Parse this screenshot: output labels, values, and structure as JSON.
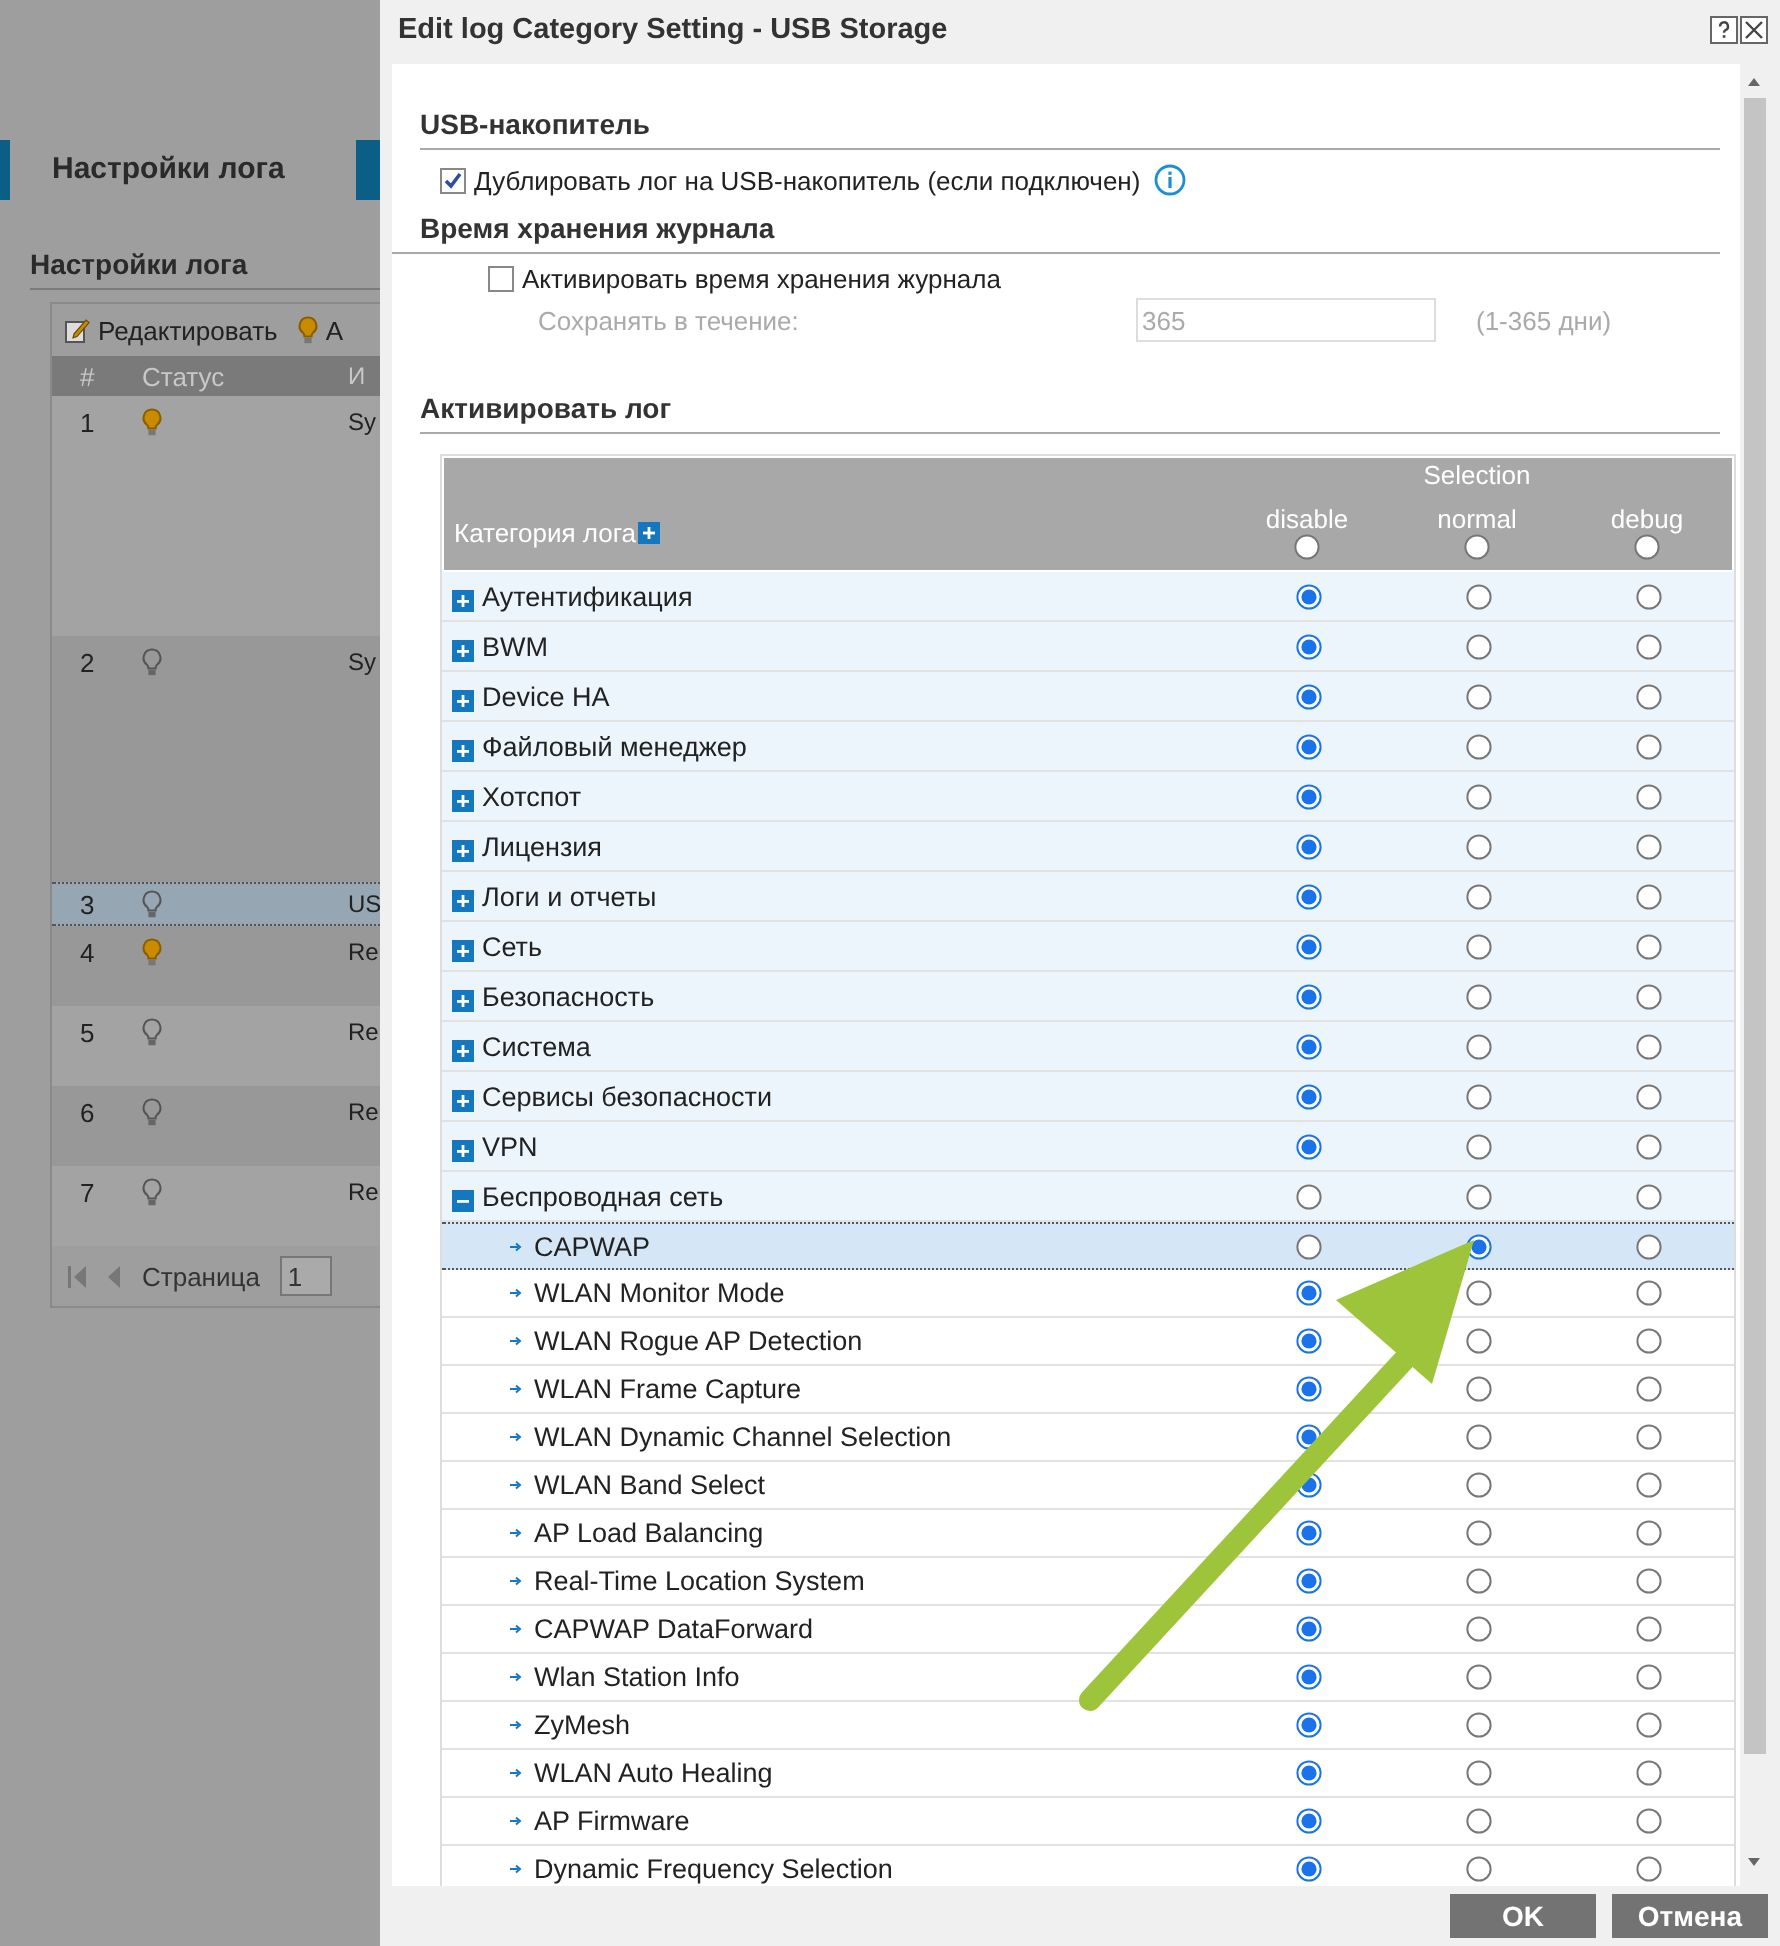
{
  "background_page": {
    "tab": {
      "label": "Настройки лога",
      "selected": true
    },
    "section_title": "Настройки лога",
    "toolbar": [
      {
        "label": "Редактировать",
        "kind": "edit"
      },
      {
        "label": "А",
        "kind": "activate"
      }
    ],
    "columns": [
      "#",
      "Статус",
      "И"
    ],
    "rows": [
      {
        "number": "1",
        "active": true,
        "name": "Sy",
        "selected": false
      },
      {
        "number": "2",
        "active": false,
        "name": "Sy",
        "selected": false
      },
      {
        "number": "3",
        "active": false,
        "name": "US",
        "selected": true
      },
      {
        "number": "4",
        "active": true,
        "name": "Re",
        "selected": false
      },
      {
        "number": "5",
        "active": false,
        "name": "Re",
        "selected": false
      },
      {
        "number": "6",
        "active": false,
        "name": "Re",
        "selected": false
      },
      {
        "number": "7",
        "active": false,
        "name": "Re",
        "selected": false
      }
    ],
    "pager": {
      "label": "Страница",
      "page": "1"
    }
  },
  "dialog": {
    "title": "Edit log Category Setting - USB Storage",
    "usb_section": {
      "title": "USB-накопитель",
      "duplicate": {
        "label": "Дублировать лог на USB-накопитель (если подключен)",
        "checked": true
      }
    },
    "retention_section": {
      "title": "Время хранения журнала",
      "enable": {
        "label": "Активировать время хранения журнала",
        "checked": false
      },
      "keep_label": "Сохранять в течение:",
      "keep_value": "365",
      "range_hint": "(1-365 дни)"
    },
    "log_section": {
      "title": "Активировать лог",
      "table": {
        "category_header": "Категория лога",
        "group_header": "Selection",
        "options": [
          "disable",
          "normal",
          "debug"
        ],
        "header_choices": [
          {
            "selected": false
          },
          {
            "selected": false
          },
          {
            "selected": false
          }
        ],
        "rows": [
          {
            "name": "Аутентификация",
            "expanded": false,
            "selected": false,
            "choices": [
              {
                "selected": true
              },
              {
                "selected": false
              },
              {
                "selected": false
              }
            ]
          },
          {
            "name": "BWM",
            "expanded": false,
            "selected": false,
            "choices": [
              {
                "selected": true
              },
              {
                "selected": false
              },
              {
                "selected": false
              }
            ]
          },
          {
            "name": "Device HA",
            "expanded": false,
            "selected": false,
            "choices": [
              {
                "selected": true
              },
              {
                "selected": false
              },
              {
                "selected": false
              }
            ]
          },
          {
            "name": "Файловый менеджер",
            "expanded": false,
            "selected": false,
            "choices": [
              {
                "selected": true
              },
              {
                "selected": false
              },
              {
                "selected": false
              }
            ]
          },
          {
            "name": "Хотспот",
            "expanded": false,
            "selected": false,
            "choices": [
              {
                "selected": true
              },
              {
                "selected": false
              },
              {
                "selected": false
              }
            ]
          },
          {
            "name": "Лицензия",
            "expanded": false,
            "selected": false,
            "choices": [
              {
                "selected": true
              },
              {
                "selected": false
              },
              {
                "selected": false
              }
            ]
          },
          {
            "name": "Логи и отчеты",
            "expanded": false,
            "selected": false,
            "choices": [
              {
                "selected": true
              },
              {
                "selected": false
              },
              {
                "selected": false
              }
            ]
          },
          {
            "name": "Сеть",
            "expanded": false,
            "selected": false,
            "choices": [
              {
                "selected": true
              },
              {
                "selected": false
              },
              {
                "selected": false
              }
            ]
          },
          {
            "name": "Безопасность",
            "expanded": false,
            "selected": false,
            "choices": [
              {
                "selected": true
              },
              {
                "selected": false
              },
              {
                "selected": false
              }
            ]
          },
          {
            "name": "Система",
            "expanded": false,
            "selected": false,
            "choices": [
              {
                "selected": true
              },
              {
                "selected": false
              },
              {
                "selected": false
              }
            ]
          },
          {
            "name": "Сервисы безопасности",
            "expanded": false,
            "selected": false,
            "choices": [
              {
                "selected": true
              },
              {
                "selected": false
              },
              {
                "selected": false
              }
            ]
          },
          {
            "name": "VPN",
            "expanded": false,
            "selected": false,
            "choices": [
              {
                "selected": true
              },
              {
                "selected": false
              },
              {
                "selected": false
              }
            ]
          },
          {
            "name": "Беспроводная сеть",
            "expanded": true,
            "selected": false,
            "choices": [
              {
                "selected": false
              },
              {
                "selected": false
              },
              {
                "selected": false
              }
            ],
            "children": [
              {
                "name": "CAPWAP",
                "selected": true,
                "choices": [
                  {
                    "selected": false
                  },
                  {
                    "selected": true
                  },
                  {
                    "selected": false
                  }
                ]
              },
              {
                "name": "WLAN Monitor Mode",
                "selected": false,
                "choices": [
                  {
                    "selected": true
                  },
                  {
                    "selected": false
                  },
                  {
                    "selected": false
                  }
                ]
              },
              {
                "name": "WLAN Rogue AP Detection",
                "selected": false,
                "choices": [
                  {
                    "selected": true
                  },
                  {
                    "selected": false
                  },
                  {
                    "selected": false
                  }
                ]
              },
              {
                "name": "WLAN Frame Capture",
                "selected": false,
                "choices": [
                  {
                    "selected": true
                  },
                  {
                    "selected": false
                  },
                  {
                    "selected": false
                  }
                ]
              },
              {
                "name": "WLAN Dynamic Channel Selection",
                "selected": false,
                "choices": [
                  {
                    "selected": true
                  },
                  {
                    "selected": false
                  },
                  {
                    "selected": false
                  }
                ]
              },
              {
                "name": "WLAN Band Select",
                "selected": false,
                "choices": [
                  {
                    "selected": true
                  },
                  {
                    "selected": false
                  },
                  {
                    "selected": false
                  }
                ]
              },
              {
                "name": "AP Load Balancing",
                "selected": false,
                "choices": [
                  {
                    "selected": true
                  },
                  {
                    "selected": false
                  },
                  {
                    "selected": false
                  }
                ]
              },
              {
                "name": "Real-Time Location System",
                "selected": false,
                "choices": [
                  {
                    "selected": true
                  },
                  {
                    "selected": false
                  },
                  {
                    "selected": false
                  }
                ]
              },
              {
                "name": "CAPWAP DataForward",
                "selected": false,
                "choices": [
                  {
                    "selected": true
                  },
                  {
                    "selected": false
                  },
                  {
                    "selected": false
                  }
                ]
              },
              {
                "name": "Wlan Station Info",
                "selected": false,
                "choices": [
                  {
                    "selected": true
                  },
                  {
                    "selected": false
                  },
                  {
                    "selected": false
                  }
                ]
              },
              {
                "name": "ZyMesh",
                "selected": false,
                "choices": [
                  {
                    "selected": true
                  },
                  {
                    "selected": false
                  },
                  {
                    "selected": false
                  }
                ]
              },
              {
                "name": "WLAN Auto Healing",
                "selected": false,
                "choices": [
                  {
                    "selected": true
                  },
                  {
                    "selected": false
                  },
                  {
                    "selected": false
                  }
                ]
              },
              {
                "name": "AP Firmware",
                "selected": false,
                "choices": [
                  {
                    "selected": true
                  },
                  {
                    "selected": false
                  },
                  {
                    "selected": false
                  }
                ]
              },
              {
                "name": "Dynamic Frequency Selection",
                "selected": false,
                "choices": [
                  {
                    "selected": true
                  },
                  {
                    "selected": false
                  },
                  {
                    "selected": false
                  }
                ]
              }
            ]
          }
        ]
      }
    },
    "buttons": [
      "OK",
      "Отмена"
    ]
  }
}
